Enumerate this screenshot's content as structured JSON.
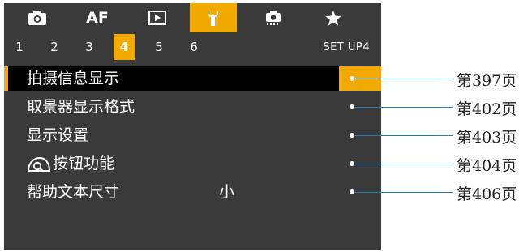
{
  "tabs": [
    {
      "icon": "camera-icon",
      "label": ""
    },
    {
      "icon": "",
      "label": "AF"
    },
    {
      "icon": "playback-icon",
      "label": ""
    },
    {
      "icon": "wrench-icon",
      "label": ""
    },
    {
      "icon": "custom-functions-icon",
      "label": ""
    },
    {
      "icon": "star-icon",
      "label": ""
    }
  ],
  "active_tab": 3,
  "subtabs": [
    "1",
    "2",
    "3",
    "4",
    "5",
    "6"
  ],
  "active_subtab": "4",
  "page_title": "SET UP4",
  "menu": [
    {
      "label": "拍摄信息显示",
      "value": "",
      "ref": "第397页"
    },
    {
      "label": "取景器显示格式",
      "value": "",
      "ref": "第402页"
    },
    {
      "label": "显示设置",
      "value": "",
      "ref": "第403页"
    },
    {
      "label": "按钮功能",
      "value": "",
      "ref": "第404页",
      "icon": "info-view-icon"
    },
    {
      "label": "帮助文本尺寸",
      "value": "小",
      "ref": "第406页"
    }
  ],
  "colors": {
    "accent": "#f2a900",
    "screen_bg": "#3a3a3a",
    "selected_bg": "#000000",
    "callout": "#1a7fc0"
  }
}
